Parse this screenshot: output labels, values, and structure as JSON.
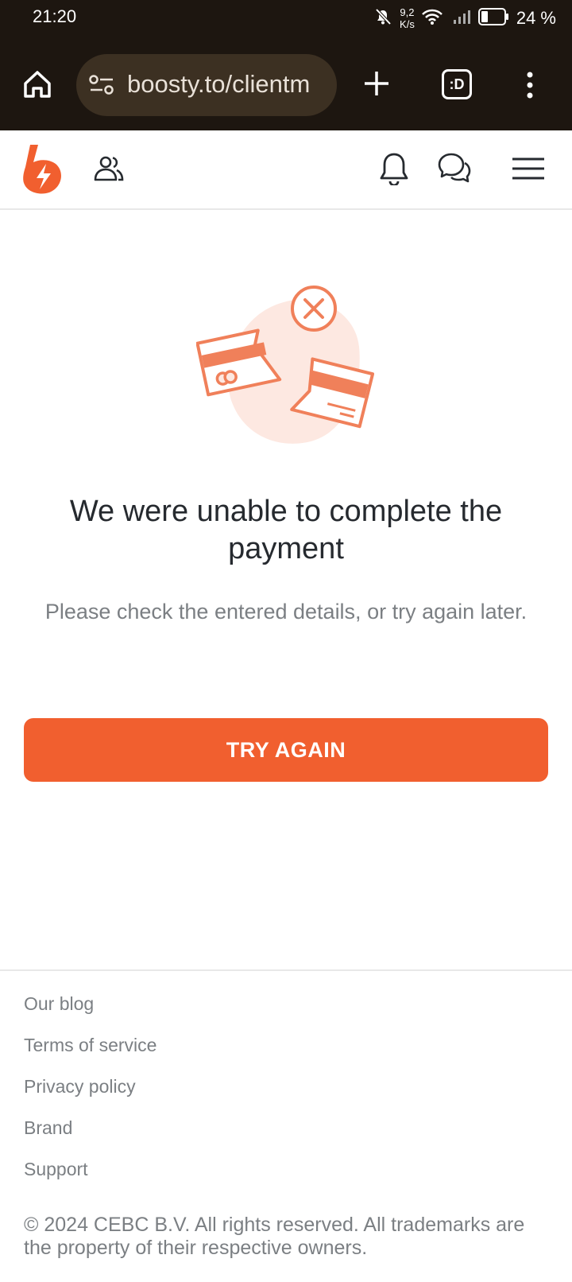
{
  "status_bar": {
    "time": "21:20",
    "net_speed_value": "9,2",
    "net_speed_unit": "K/s",
    "battery": "24 %"
  },
  "browser": {
    "url": "boosty.to/clientm",
    "tabs_label": ":D"
  },
  "page": {
    "title": "We were unable to complete the payment",
    "subtitle": "Please check the entered details, or try again later.",
    "button_label": "TRY AGAIN"
  },
  "footer": {
    "links": [
      "Our blog",
      "Terms of service",
      "Privacy policy",
      "Brand",
      "Support"
    ],
    "copyright": "© 2024 CEBC B.V. All rights reserved. All trademarks are the property of their respective owners."
  },
  "colors": {
    "accent": "#f15f2f",
    "illustration": "#f0805a",
    "chrome_bg": "#1d1610"
  }
}
